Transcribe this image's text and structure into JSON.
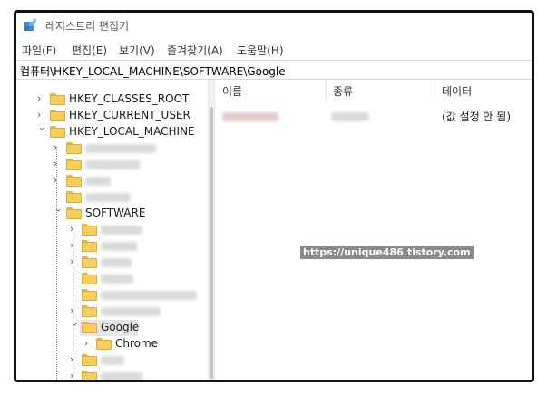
{
  "window": {
    "title": "레지스트리 편집기",
    "app_icon": "regedit-icon"
  },
  "menu": [
    {
      "label": "파일(F)"
    },
    {
      "label": "편집(E)"
    },
    {
      "label": "보기(V)"
    },
    {
      "label": "즐겨찾기(A)"
    },
    {
      "label": "도움말(H)"
    }
  ],
  "address": {
    "path": "컴퓨터\\HKEY_LOCAL_MACHINE\\SOFTWARE\\Google"
  },
  "tree": {
    "hkcr": "HKEY_CLASSES_ROOT",
    "hkcu": "HKEY_CURRENT_USER",
    "hklm": "HKEY_LOCAL_MACHINE",
    "software": "SOFTWARE",
    "google": "Google",
    "chrome": "Chrome"
  },
  "list": {
    "columns": {
      "name": "이름",
      "type": "종류",
      "data": "데이터"
    },
    "rows": [
      {
        "data": "(값 설정 안 됨)"
      }
    ]
  },
  "watermark": "https://unique486.tistory.com",
  "colors": {
    "folder": "#f7cd5b",
    "folder_border": "#e2ac32",
    "selection": "#e5e5e5",
    "frame": "#111111"
  }
}
